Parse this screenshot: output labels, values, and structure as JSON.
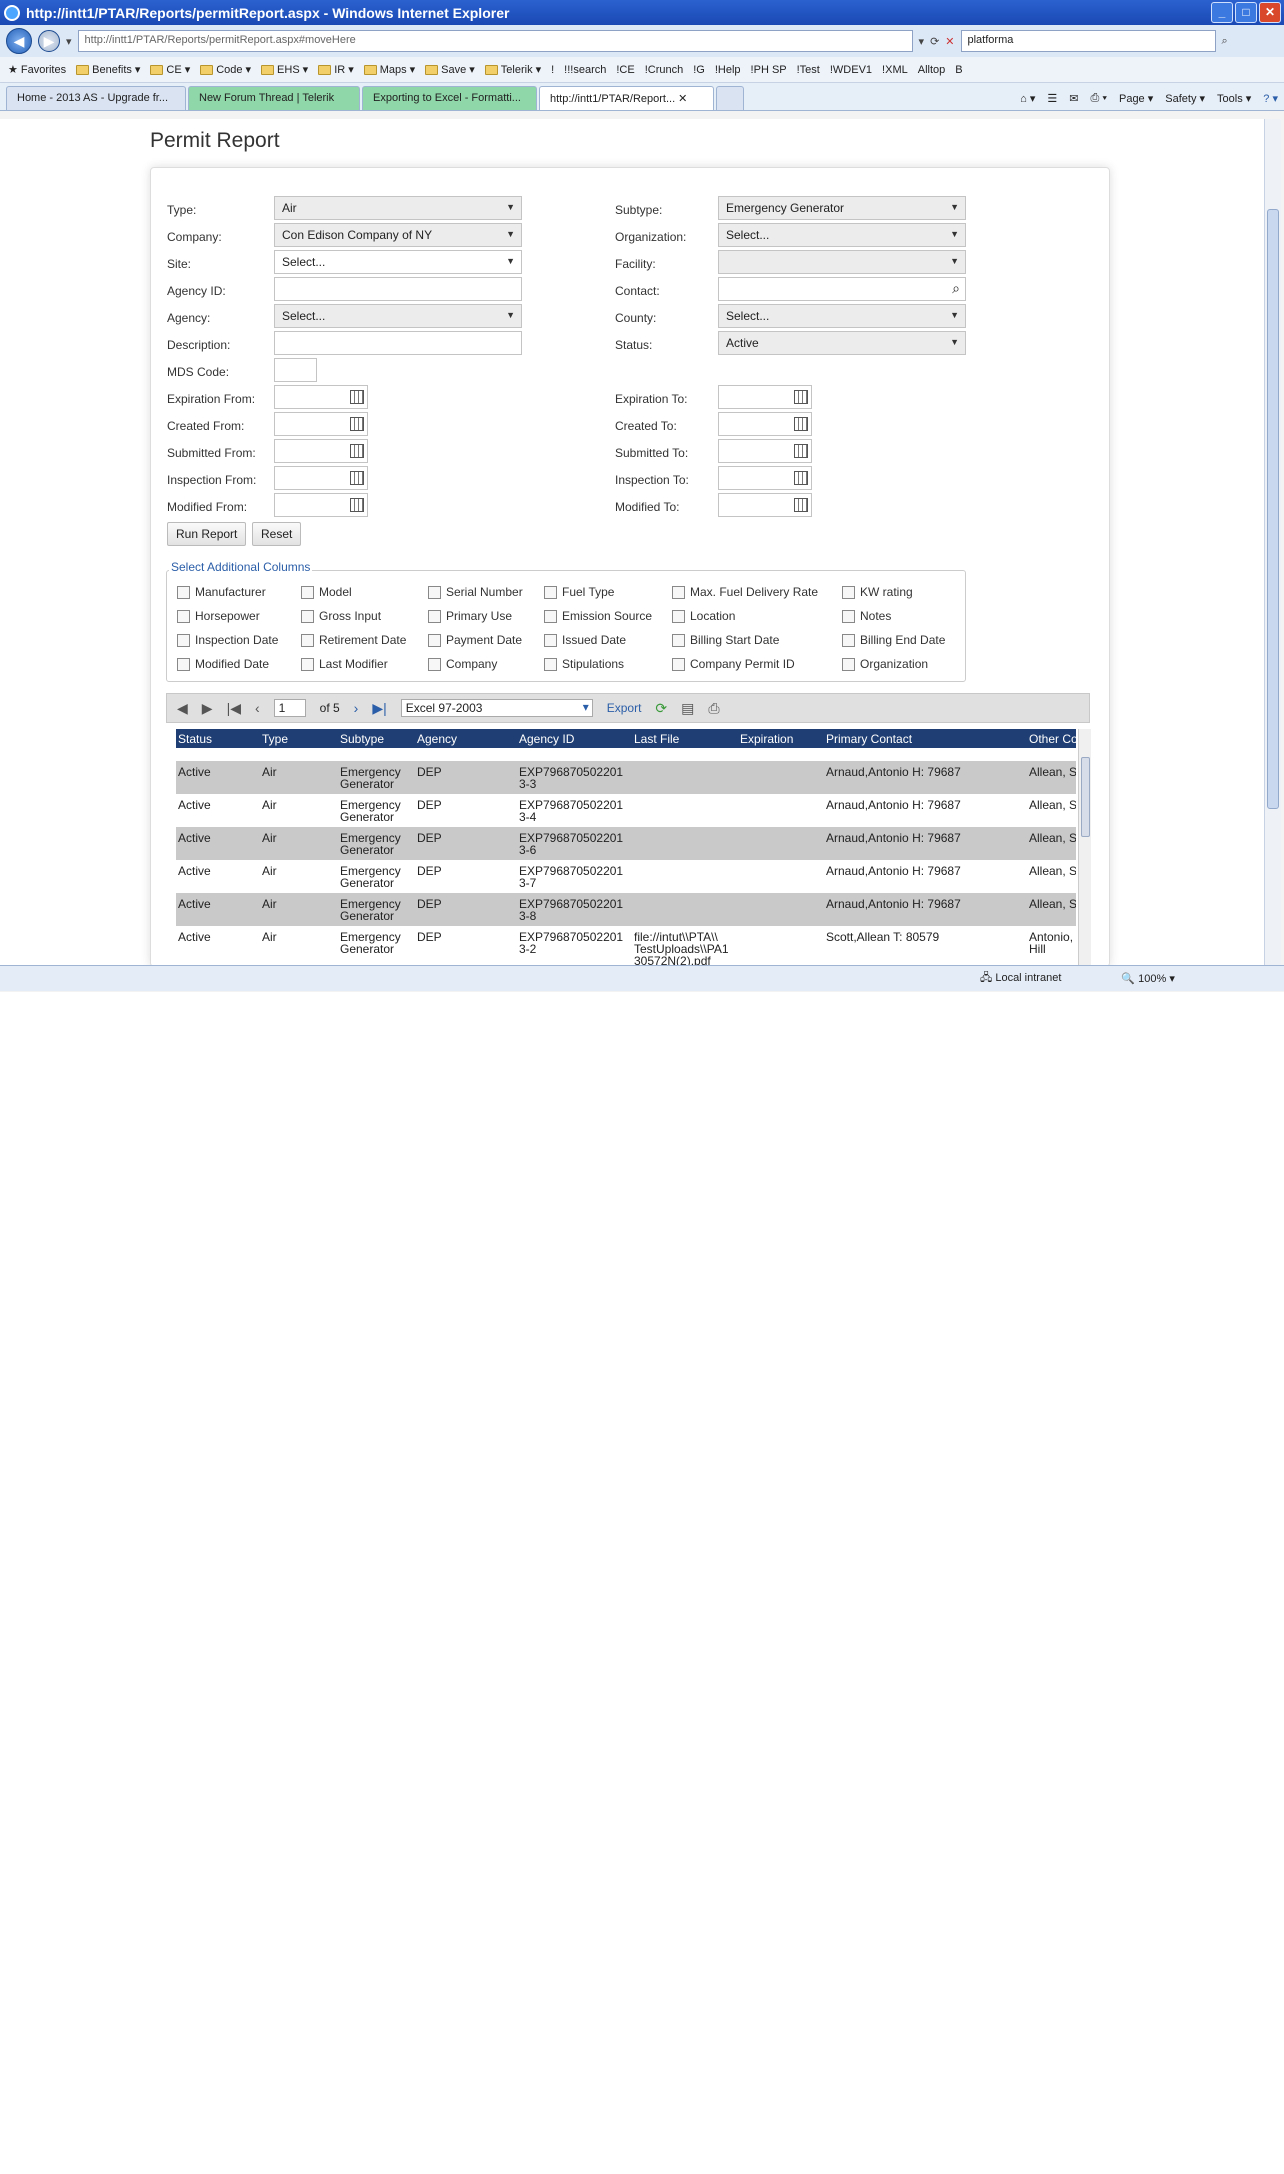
{
  "window": {
    "title": "http://intt1/PTAR/Reports/permitReport.aspx - Windows Internet Explorer"
  },
  "address": {
    "url": "http://intt1/PTAR/Reports/permitReport.aspx#moveHere",
    "search": "platforma"
  },
  "favorites": [
    "Favorites",
    "Benefits",
    "CE",
    "Code",
    "EHS",
    "IR",
    "Maps",
    "Save",
    "Telerik",
    "!",
    "!!!search",
    "!CE",
    "!Crunch",
    "!G",
    "!Help",
    "!PH SP",
    "!Test",
    "!WDEV1",
    "!XML",
    "Alltop",
    "B"
  ],
  "tabs": [
    "Home - 2013 AS - Upgrade fr...",
    "New Forum Thread | Telerik",
    "Exporting to Excel - Formatti...",
    "http://intt1/PTAR/Report..."
  ],
  "tab_tools": [
    "Page ▾",
    "Safety ▾",
    "Tools ▾"
  ],
  "status": {
    "zone": "Local intranet",
    "zoom": "100%"
  },
  "page": {
    "title": "Permit Report"
  },
  "form": {
    "type_label": "Type:",
    "type_value": "Air",
    "company_label": "Company:",
    "company_value": "Con Edison Company of NY",
    "site_label": "Site:",
    "site_value": "Select...",
    "agency_id_label": "Agency ID:",
    "agency_label": "Agency:",
    "agency_value": "Select...",
    "description_label": "Description:",
    "mds_label": "MDS Code:",
    "subtype_label": "Subtype:",
    "subtype_value": "Emergency Generator",
    "organization_label": "Organization:",
    "organization_value": "Select...",
    "facility_label": "Facility:",
    "contact_label": "Contact:",
    "county_label": "County:",
    "county_value": "Select...",
    "status_label": "Status:",
    "status_value": "Active",
    "exp_from": "Expiration From:",
    "created_from": "Created From:",
    "submitted_from": "Submitted From:",
    "inspection_from": "Inspection From:",
    "modified_from": "Modified From:",
    "exp_to": "Expiration To:",
    "created_to": "Created To:",
    "submitted_to": "Submitted To:",
    "inspection_to": "Inspection To:",
    "modified_to": "Modified To:",
    "run_report": "Run Report",
    "reset": "Reset"
  },
  "columns_legend": "Select Additional Columns",
  "columns": [
    "Manufacturer",
    "Model",
    "Serial Number",
    "Fuel Type",
    "Max. Fuel Delivery Rate",
    "KW rating",
    "Horsepower",
    "Gross Input",
    "Primary Use",
    "Emission Source",
    "Location",
    "Notes",
    "Inspection Date",
    "Retirement Date",
    "Payment Date",
    "Issued Date",
    "Billing Start Date",
    "Billing End Date",
    "Modified Date",
    "Last Modifier",
    "Company",
    "Stipulations",
    "Company Permit ID",
    "Organization"
  ],
  "pager": {
    "page": "1",
    "of": "of 5",
    "format": "Excel 97-2003",
    "export": "Export"
  },
  "grid": {
    "headers": [
      "Status",
      "Type",
      "Subtype",
      "Agency",
      "Agency ID",
      "Last File",
      "Expiration",
      "Primary Contact",
      "Other Co"
    ],
    "rows": [
      {
        "status": "Active",
        "type": "Air",
        "subtype": "Emergency Generator",
        "agency": "DEP",
        "agency_id": "EXP796870502201 3-3",
        "last_file": "",
        "expiration": "",
        "contact": "Arnaud,Antonio H: 79687",
        "other": "Allean, Sc"
      },
      {
        "status": "Active",
        "type": "Air",
        "subtype": "Emergency Generator",
        "agency": "DEP",
        "agency_id": "EXP796870502201 3-4",
        "last_file": "",
        "expiration": "",
        "contact": "Arnaud,Antonio H: 79687",
        "other": "Allean, Sc"
      },
      {
        "status": "Active",
        "type": "Air",
        "subtype": "Emergency Generator",
        "agency": "DEP",
        "agency_id": "EXP796870502201 3-6",
        "last_file": "",
        "expiration": "",
        "contact": "Arnaud,Antonio H: 79687",
        "other": "Allean, Sc"
      },
      {
        "status": "Active",
        "type": "Air",
        "subtype": "Emergency Generator",
        "agency": "DEP",
        "agency_id": "EXP796870502201 3-7",
        "last_file": "",
        "expiration": "",
        "contact": "Arnaud,Antonio H: 79687",
        "other": "Allean, Sc"
      },
      {
        "status": "Active",
        "type": "Air",
        "subtype": "Emergency Generator",
        "agency": "DEP",
        "agency_id": "EXP796870502201 3-8",
        "last_file": "",
        "expiration": "",
        "contact": "Arnaud,Antonio H: 79687",
        "other": "Allean, Sc"
      },
      {
        "status": "Active",
        "type": "Air",
        "subtype": "Emergency Generator",
        "agency": "DEP",
        "agency_id": "EXP796870502201 3-2",
        "last_file": "file://intut\\\\PTA\\\\ TestUploads\\\\PA1 30572N(2).pdf",
        "expiration": "",
        "contact": "Scott,Allean T: 80579",
        "other": "Antonio, David, Hill"
      }
    ]
  }
}
